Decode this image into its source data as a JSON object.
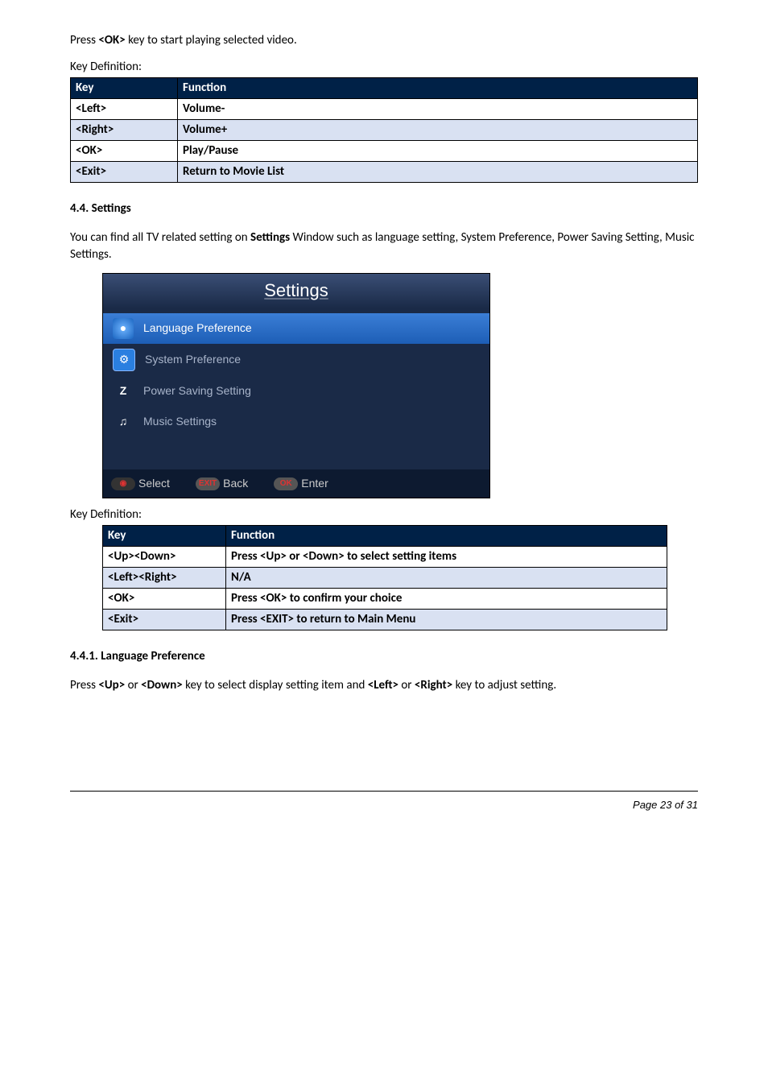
{
  "intro": {
    "line1_pre": "Press ",
    "line1_key": "<OK>",
    "line1_post": " key to start playing selected video."
  },
  "keydef_label": "Key Definition:",
  "table1": {
    "header_key": "Key",
    "header_func": "Function",
    "rows": [
      {
        "key": "<Left>",
        "func": "Volume-"
      },
      {
        "key": "<Right>",
        "func": "Volume+"
      },
      {
        "key": "<OK>",
        "func": "Play/Pause"
      },
      {
        "key": "<Exit>",
        "func": "Return to Movie List"
      }
    ]
  },
  "section44": {
    "heading": "4.4. Settings",
    "desc_pre": "You can find all TV related setting on ",
    "desc_bold": "Settings",
    "desc_post": " Window such as language setting, System Preference, Power Saving Setting, Music Settings."
  },
  "settings_screenshot": {
    "title": "Settings",
    "items": [
      {
        "label": "Language Preference",
        "iconClass": "icon-lang",
        "iconGlyph": "●"
      },
      {
        "label": "System Preference",
        "iconClass": "icon-sys",
        "iconGlyph": "⚙"
      },
      {
        "label": "Power Saving Setting",
        "iconClass": "icon-power",
        "iconGlyph": "Z"
      },
      {
        "label": "Music Settings",
        "iconClass": "icon-music",
        "iconGlyph": "♫"
      }
    ],
    "footer": {
      "select": "Select",
      "back": "Back",
      "back_badge": "EXIT",
      "enter": "Enter",
      "enter_badge": "OK"
    }
  },
  "table2": {
    "header_key": "Key",
    "header_func": "Function",
    "rows": [
      {
        "key": "<Up><Down>",
        "func": "Press <Up> or <Down> to select setting items"
      },
      {
        "key": "<Left><Right>",
        "func": "N/A"
      },
      {
        "key": "<OK>",
        "func": "Press <OK> to confirm your choice"
      },
      {
        "key": "<Exit>",
        "func": "Press <EXIT> to return to Main Menu"
      }
    ]
  },
  "section441": {
    "heading": "4.4.1. Language Preference",
    "t1": "Press ",
    "b1": "<Up>",
    "t2": " or ",
    "b2": "<Down>",
    "t3": " key to select display setting item and ",
    "b3": "<Left>",
    "t4": " or ",
    "b4": "<Right>",
    "t5": " key to adjust setting."
  },
  "page_footer": "Page 23 of 31"
}
